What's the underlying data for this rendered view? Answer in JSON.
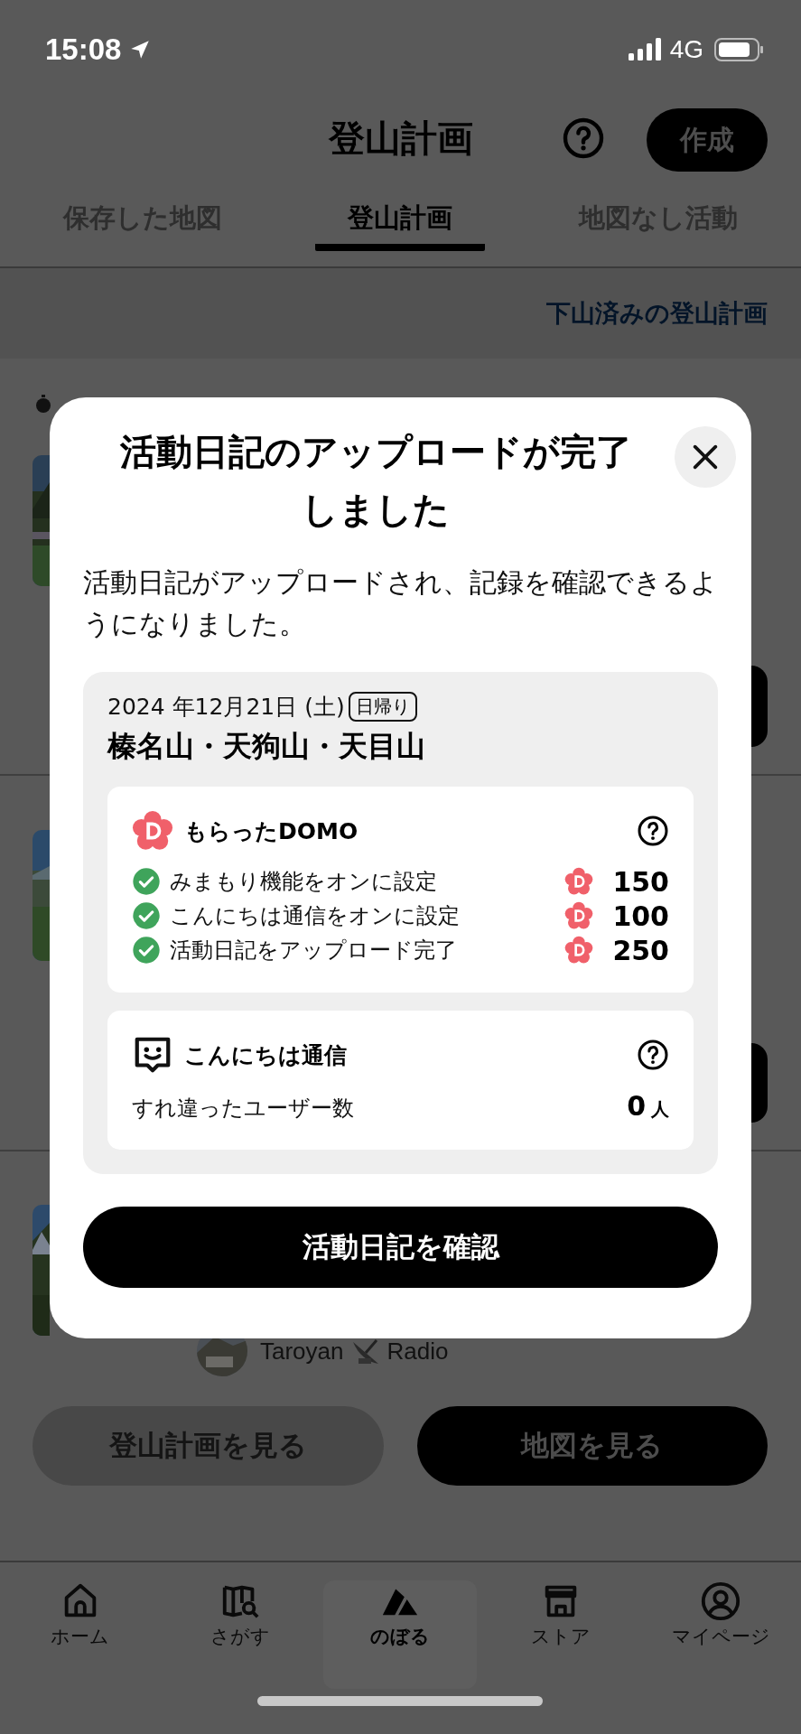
{
  "status_bar": {
    "time": "15:08",
    "network": "4G"
  },
  "header": {
    "title": "登山計画",
    "create_button": "作成"
  },
  "tabs": [
    {
      "label": "保存した地図",
      "selected": false
    },
    {
      "label": "登山計画",
      "selected": true
    },
    {
      "label": "地図なし活動",
      "selected": false
    }
  ],
  "completed_plans_link": "下山済みの登山計画",
  "plan_card": {
    "author_before_icon": "Taroyan",
    "author_after_icon": "Radio",
    "view_plan_button": "登山計画を見る",
    "view_map_button": "地図を見る"
  },
  "modal": {
    "title": "活動日記のアップロードが完了しました",
    "message": "活動日記がアップロードされ、記録を確認できるようになりました。",
    "activity": {
      "date": "2024 年12月21日 (土)",
      "trip_type": "日帰り",
      "name": "榛名山・天狗山・天目山"
    },
    "domo": {
      "title": "もらったDOMO",
      "items": [
        {
          "label": "みまもり機能をオンに設定",
          "points": "150",
          "checked": true
        },
        {
          "label": "こんにちは通信をオンに設定",
          "points": "100",
          "checked": true
        },
        {
          "label": "活動日記をアップロード完了",
          "points": "250",
          "checked": true
        }
      ]
    },
    "konnichiwa": {
      "title": "こんにちは通信",
      "label": "すれ違ったユーザー数",
      "count": "0",
      "unit": "人"
    },
    "confirm_button": "活動日記を確認"
  },
  "bottom_nav": [
    {
      "kind": "home",
      "label": "ホーム",
      "selected": false
    },
    {
      "kind": "search",
      "label": "さがす",
      "selected": false
    },
    {
      "kind": "climb",
      "label": "のぼる",
      "selected": true
    },
    {
      "kind": "store",
      "label": "ストア",
      "selected": false
    },
    {
      "kind": "mypage",
      "label": "マイページ",
      "selected": false
    }
  ]
}
